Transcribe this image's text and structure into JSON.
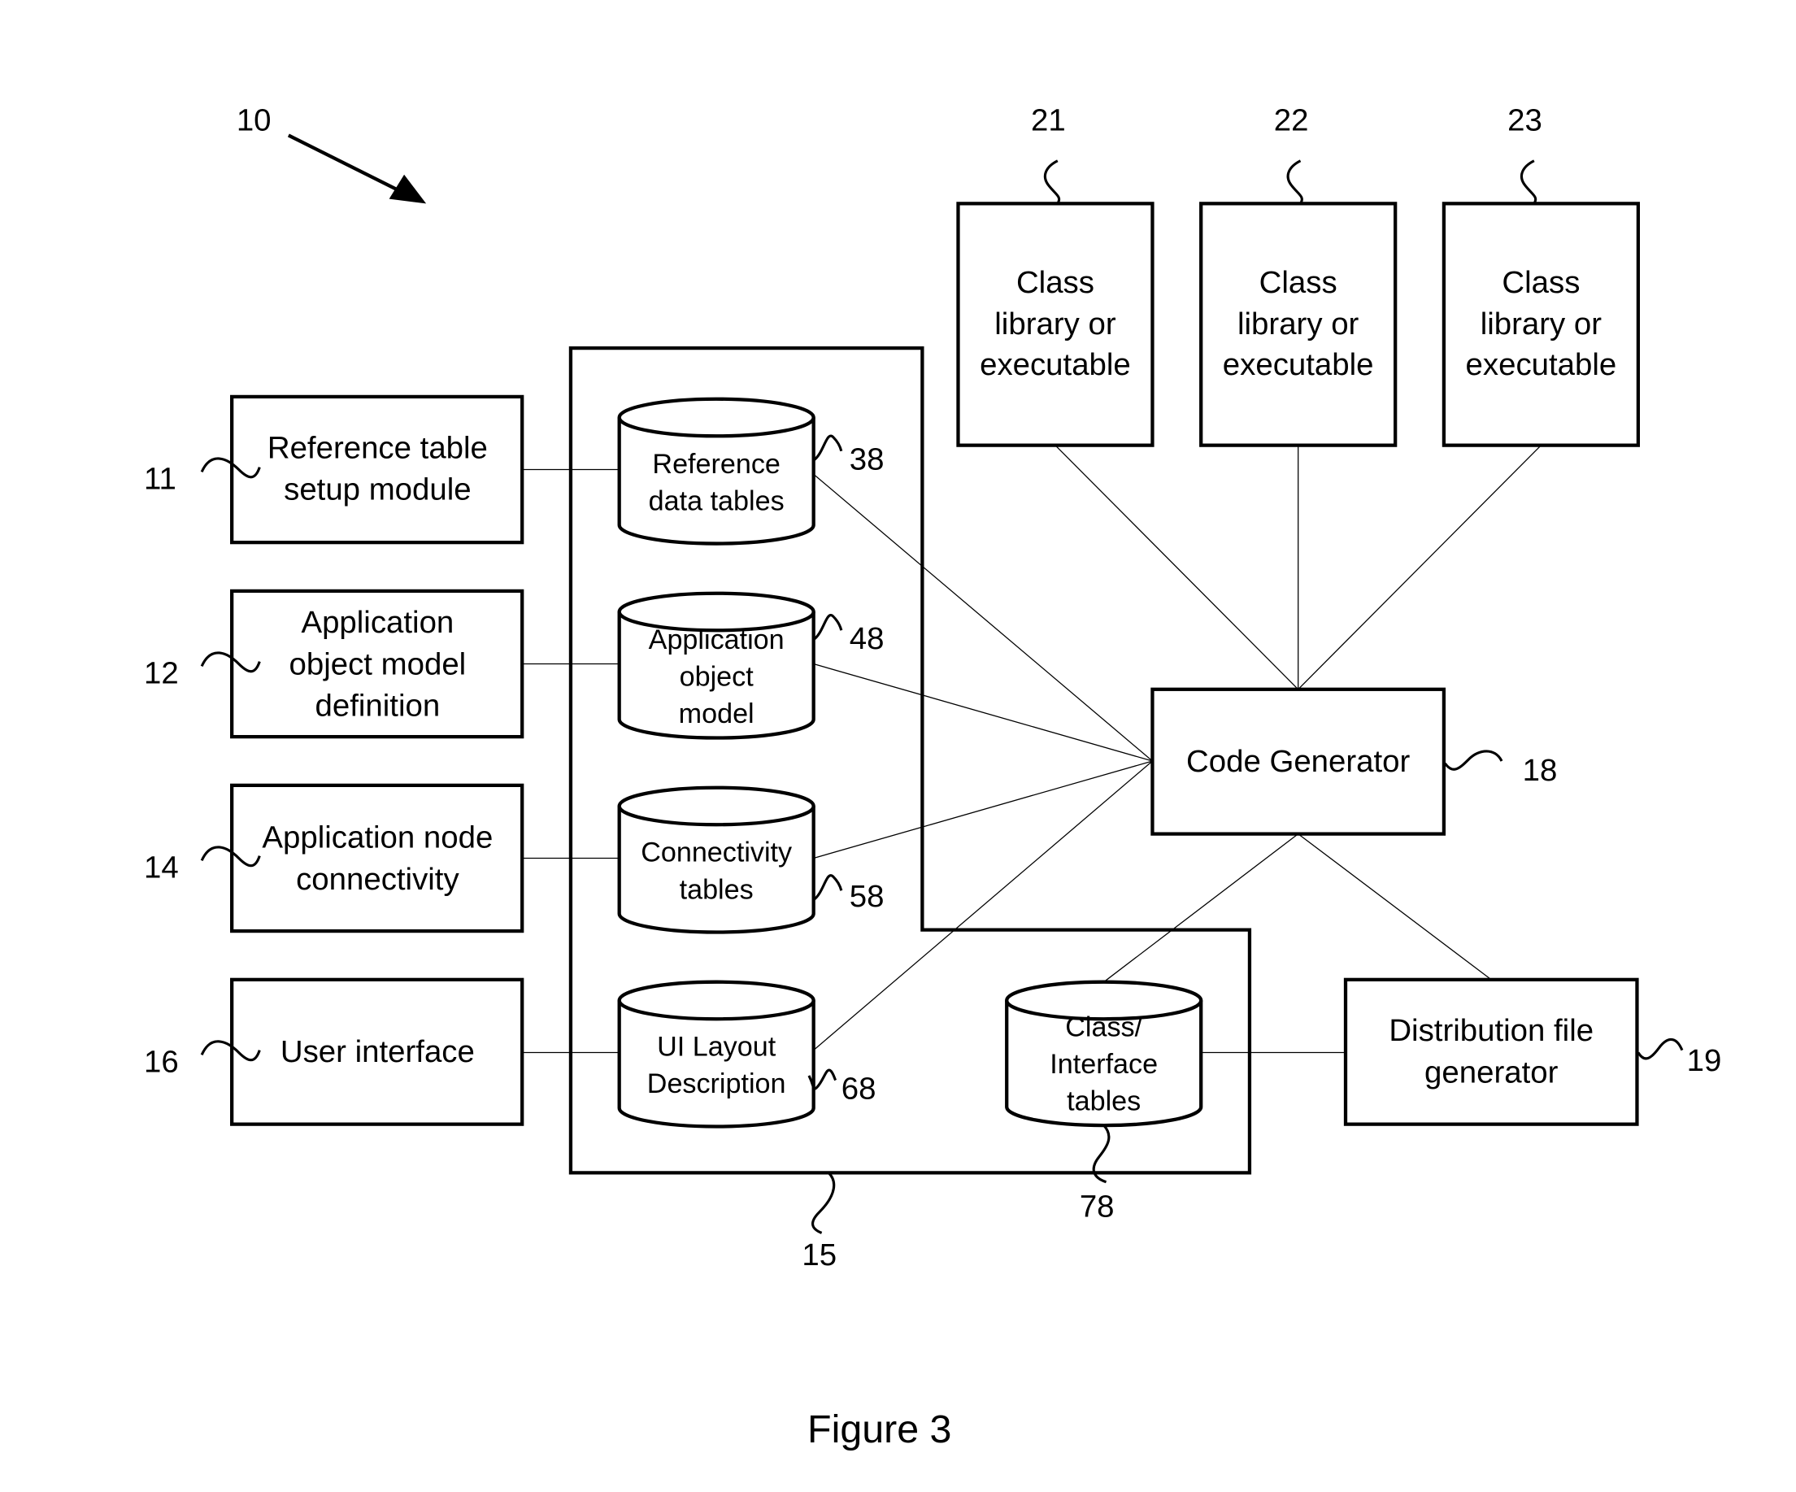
{
  "figure": {
    "caption": "Figure 3",
    "system_ref": "10"
  },
  "input_modules": [
    {
      "ref": "11",
      "lines": [
        "Reference table",
        "setup module"
      ]
    },
    {
      "ref": "12",
      "lines": [
        "Application",
        "object model",
        "definition"
      ]
    },
    {
      "ref": "14",
      "lines": [
        "Application node",
        "connectivity"
      ]
    },
    {
      "ref": "16",
      "lines": [
        "User interface"
      ]
    }
  ],
  "repository": {
    "ref": "15",
    "stores": [
      {
        "ref": "38",
        "lines": [
          "Reference",
          "data tables"
        ]
      },
      {
        "ref": "48",
        "lines": [
          "Application",
          "object",
          "model"
        ]
      },
      {
        "ref": "58",
        "lines": [
          "Connectivity",
          "tables"
        ]
      },
      {
        "ref": "68",
        "lines": [
          "UI Layout",
          "Description"
        ]
      },
      {
        "ref": "78",
        "lines": [
          "Class/",
          "Interface",
          "tables"
        ]
      }
    ]
  },
  "outputs": [
    {
      "ref": "21",
      "lines": [
        "Class",
        "library or",
        "executable"
      ]
    },
    {
      "ref": "22",
      "lines": [
        "Class",
        "library or",
        "executable"
      ]
    },
    {
      "ref": "23",
      "lines": [
        "Class",
        "library or",
        "executable"
      ]
    }
  ],
  "code_generator": {
    "ref": "18",
    "label": "Code Generator"
  },
  "distribution": {
    "ref": "19",
    "lines": [
      "Distribution file",
      "generator"
    ]
  }
}
